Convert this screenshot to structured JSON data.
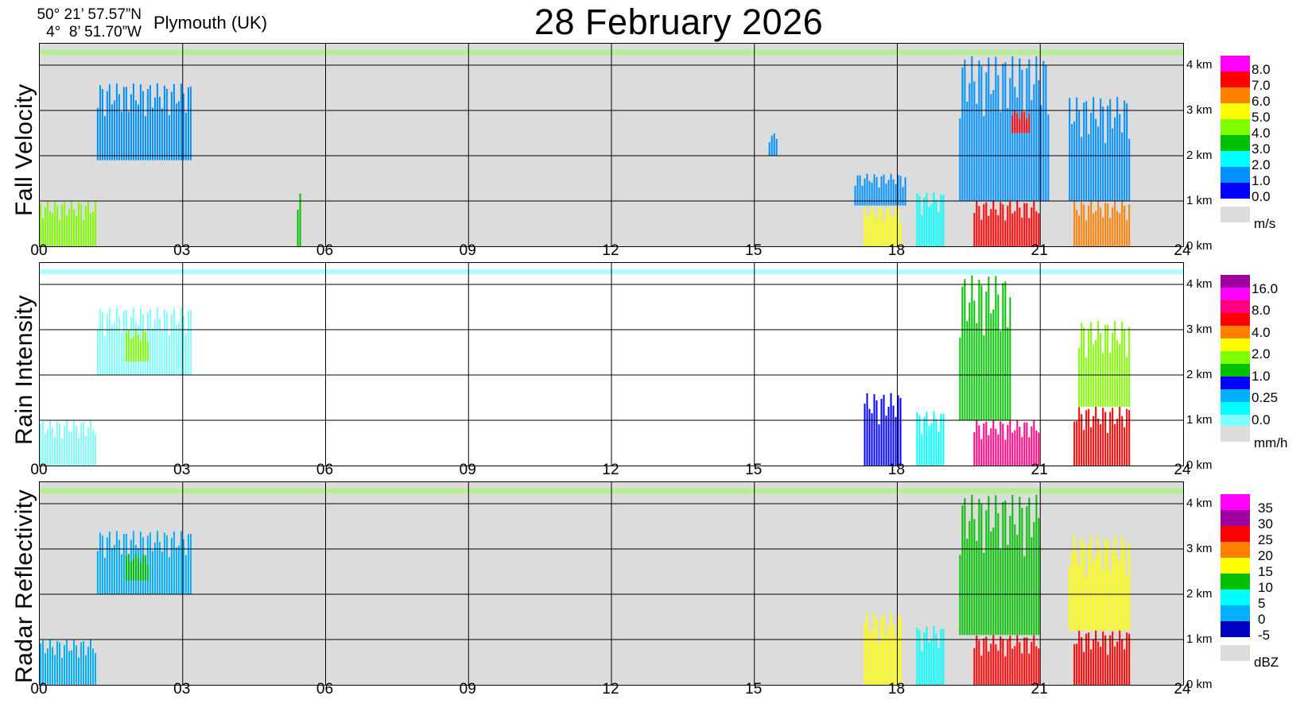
{
  "header": {
    "lat": "50° 21’ 57.57”N",
    "lon": "4°  8’ 51.70”W",
    "station": "Plymouth (UK)",
    "date": "28 February  2026"
  },
  "x_ticks": [
    "00",
    "03",
    "06",
    "09",
    "12",
    "15",
    "18",
    "21",
    "24"
  ],
  "height_ticks": [
    "4 km",
    "3 km",
    "2 km",
    "1 km",
    "0 km"
  ],
  "chart_data": [
    {
      "type": "heatmap",
      "title": "Fall Velocity",
      "ylabel": "Fall Velocity",
      "unit": "m/s",
      "xlim": [
        0,
        24
      ],
      "ylim": [
        0,
        4
      ],
      "x_ticks": [
        "00",
        "03",
        "06",
        "09",
        "12",
        "15",
        "18",
        "21",
        "24"
      ],
      "y_ticks": [
        "0 km",
        "1 km",
        "2 km",
        "3 km",
        "4 km"
      ],
      "colorbar": {
        "labels": [
          "8.0",
          "7.0",
          "6.0",
          "5.0",
          "4.0",
          "3.0",
          "2.0",
          "1.0",
          "0.0"
        ],
        "colors": [
          "#ff00ff",
          "#ff0000",
          "#ff8000",
          "#ffff00",
          "#80ff00",
          "#00c000",
          "#00ffff",
          "#0090ff",
          "#0000ff"
        ]
      },
      "background": "#dcdcdc",
      "cells": [
        {
          "x0": 1.2,
          "x1": 3.2,
          "y0": 1.9,
          "y1": 3.6,
          "v": 0.5
        },
        {
          "x0": 0.0,
          "x1": 1.2,
          "y0": 0.0,
          "y1": 1.0,
          "v": 3.5
        },
        {
          "x0": 17.3,
          "x1": 18.1,
          "y0": 0.0,
          "y1": 0.9,
          "v": 5.0
        },
        {
          "x0": 17.1,
          "x1": 18.2,
          "y0": 0.9,
          "y1": 1.6,
          "v": 1.0
        },
        {
          "x0": 18.4,
          "x1": 19.0,
          "y0": 0.0,
          "y1": 1.2,
          "v": 1.5
        },
        {
          "x0": 19.6,
          "x1": 21.0,
          "y0": 0.0,
          "y1": 1.0,
          "v": 6.5
        },
        {
          "x0": 19.3,
          "x1": 21.2,
          "y0": 1.0,
          "y1": 4.2,
          "v": 1.0
        },
        {
          "x0": 20.4,
          "x1": 20.8,
          "y0": 2.5,
          "y1": 3.0,
          "v": 6.5
        },
        {
          "x0": 21.7,
          "x1": 22.9,
          "y0": 0.0,
          "y1": 1.0,
          "v": 5.5
        },
        {
          "x0": 21.6,
          "x1": 22.9,
          "y0": 1.0,
          "y1": 3.3,
          "v": 1.0
        },
        {
          "x0": 15.3,
          "x1": 15.5,
          "y0": 2.0,
          "y1": 2.5,
          "v": 0.5
        },
        {
          "x0": 5.4,
          "x1": 5.5,
          "y0": 0.0,
          "y1": 1.2,
          "v": 3.0
        }
      ]
    },
    {
      "type": "heatmap",
      "title": "Rain Intensity",
      "ylabel": "Rain Intensity",
      "unit": "mm/h",
      "xlim": [
        0,
        24
      ],
      "ylim": [
        0,
        4
      ],
      "x_ticks": [
        "00",
        "03",
        "06",
        "09",
        "12",
        "15",
        "18",
        "21",
        "24"
      ],
      "y_ticks": [
        "0 km",
        "1 km",
        "2 km",
        "3 km",
        "4 km"
      ],
      "colorbar": {
        "labels": [
          "16.0",
          "8.0",
          "4.0",
          "2.0",
          "1.0",
          "0.25",
          "0.0"
        ],
        "colors": [
          "#a000a0",
          "#ff00ff",
          "#ff0080",
          "#ff0000",
          "#ff8000",
          "#ffff00",
          "#80ff00",
          "#00c000",
          "#0000ff",
          "#00b0ff",
          "#00ffff",
          "#80ffff"
        ]
      },
      "background": "#ffffff",
      "cells": [
        {
          "x0": 1.2,
          "x1": 3.2,
          "y0": 2.0,
          "y1": 3.5,
          "v": 0.1
        },
        {
          "x0": 1.8,
          "x1": 2.3,
          "y0": 2.3,
          "y1": 3.0,
          "v": 2.0
        },
        {
          "x0": 0.0,
          "x1": 1.2,
          "y0": 0.0,
          "y1": 1.0,
          "v": 0.2
        },
        {
          "x0": 17.3,
          "x1": 18.1,
          "y0": 0.0,
          "y1": 1.6,
          "v": 1.0
        },
        {
          "x0": 18.4,
          "x1": 19.0,
          "y0": 0.0,
          "y1": 1.2,
          "v": 0.3
        },
        {
          "x0": 19.6,
          "x1": 21.0,
          "y0": 0.0,
          "y1": 1.0,
          "v": 8.0
        },
        {
          "x0": 19.3,
          "x1": 20.4,
          "y0": 1.0,
          "y1": 4.2,
          "v": 1.5
        },
        {
          "x0": 21.7,
          "x1": 22.9,
          "y0": 0.0,
          "y1": 1.3,
          "v": 6.0
        },
        {
          "x0": 21.8,
          "x1": 22.9,
          "y0": 1.3,
          "y1": 3.2,
          "v": 2.0
        }
      ]
    },
    {
      "type": "heatmap",
      "title": "Radar Reflectivity",
      "ylabel": "Radar Reflectivity",
      "unit": "dBZ",
      "xlim": [
        0,
        24
      ],
      "ylim": [
        0,
        4
      ],
      "x_ticks": [
        "00",
        "03",
        "06",
        "09",
        "12",
        "15",
        "18",
        "21",
        "24"
      ],
      "y_ticks": [
        "0 km",
        "1 km",
        "2 km",
        "3 km",
        "4 km"
      ],
      "colorbar": {
        "labels": [
          "35",
          "30",
          "25",
          "20",
          "15",
          "10",
          "5",
          "0",
          "-5"
        ],
        "colors": [
          "#ff00ff",
          "#a000a0",
          "#ff0000",
          "#ff8000",
          "#ffff00",
          "#00c000",
          "#00ffff",
          "#00b0ff",
          "#0000c0"
        ]
      },
      "background": "#dcdcdc",
      "cells": [
        {
          "x0": 1.2,
          "x1": 3.2,
          "y0": 2.0,
          "y1": 3.4,
          "v": 3
        },
        {
          "x0": 1.8,
          "x1": 2.3,
          "y0": 2.3,
          "y1": 2.9,
          "v": 12
        },
        {
          "x0": 0.0,
          "x1": 1.2,
          "y0": 0.0,
          "y1": 1.0,
          "v": 2
        },
        {
          "x0": 17.3,
          "x1": 18.1,
          "y0": 0.0,
          "y1": 1.6,
          "v": 18
        },
        {
          "x0": 18.4,
          "x1": 19.0,
          "y0": 0.0,
          "y1": 1.3,
          "v": 8
        },
        {
          "x0": 19.6,
          "x1": 21.0,
          "y0": 0.0,
          "y1": 1.1,
          "v": 27
        },
        {
          "x0": 19.3,
          "x1": 21.0,
          "y0": 1.1,
          "y1": 4.2,
          "v": 14
        },
        {
          "x0": 21.7,
          "x1": 22.9,
          "y0": 0.0,
          "y1": 1.2,
          "v": 26
        },
        {
          "x0": 21.6,
          "x1": 22.9,
          "y0": 1.2,
          "y1": 3.3,
          "v": 15
        }
      ]
    }
  ]
}
